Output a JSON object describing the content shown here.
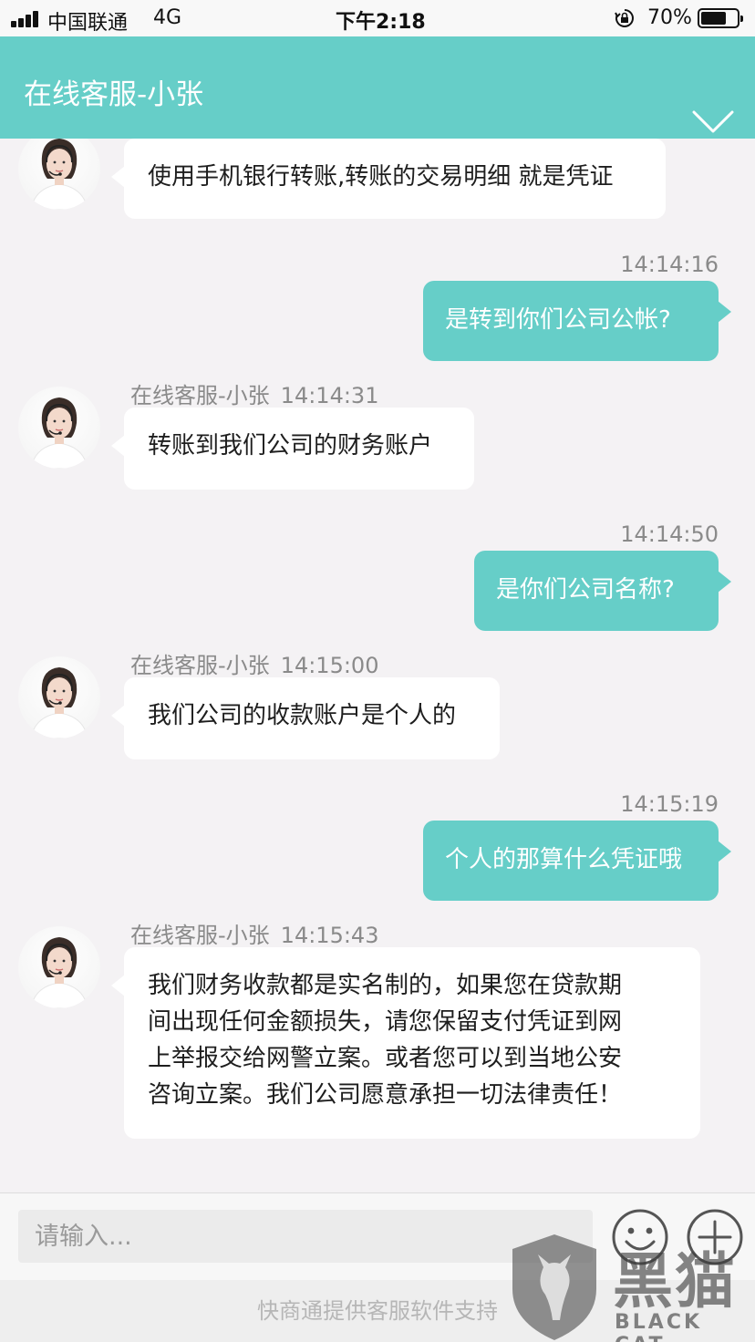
{
  "status_bar": {
    "carrier": "中国联通",
    "network": "4G",
    "time": "下午2:18",
    "battery_percent": "70%",
    "battery_level": 0.7
  },
  "header": {
    "title": "在线客服-小张",
    "collapse_icon": "chevron-down-icon"
  },
  "messages": [
    {
      "direction": "incoming",
      "text": "使用手机银行转账,转账的交易明细 就是凭证"
    },
    {
      "direction": "outgoing",
      "time": "14:14:16",
      "text": "是转到你们公司公帐?"
    },
    {
      "direction": "incoming",
      "sender": "在线客服-小张",
      "time": "14:14:31",
      "text": "转账到我们公司的财务账户"
    },
    {
      "direction": "outgoing",
      "time": "14:14:50",
      "text": "是你们公司名称?"
    },
    {
      "direction": "incoming",
      "sender": "在线客服-小张",
      "time": "14:15:00",
      "text": "我们公司的收款账户是个人的"
    },
    {
      "direction": "outgoing",
      "time": "14:15:19",
      "text": "个人的那算什么凭证哦"
    },
    {
      "direction": "incoming",
      "sender": "在线客服-小张",
      "time": "14:15:43",
      "lines": [
        "我们财务收款都是实名制的，如果您在贷款期",
        "间出现任何金额损失，请您保留支付凭证到网",
        "上举报交给网警立案。或者您可以到当地公安",
        "咨询立案。我们公司愿意承担一切法律责任！"
      ]
    }
  ],
  "input": {
    "placeholder": "请输入...",
    "emoji_icon": "smiley-icon",
    "add_icon": "plus-circle-icon"
  },
  "footer": {
    "text": "快商通提供客服软件支持"
  },
  "watermark": {
    "cn": "黑猫",
    "en": "BLACK CAT"
  },
  "colors": {
    "accent": "#66cec8",
    "background": "#f4f2f4",
    "bubble_in": "#ffffff"
  }
}
